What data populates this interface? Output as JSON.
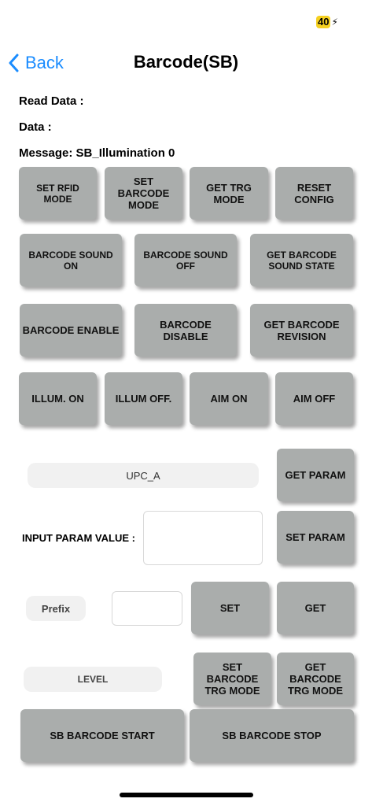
{
  "status": {
    "battery": "40",
    "bolt": "⚡"
  },
  "nav": {
    "back_label": "Back",
    "title": "Barcode(SB)"
  },
  "info": {
    "read_data": "Read Data :",
    "data": "Data :",
    "message": "Message: SB_Illumination 0"
  },
  "row1": [
    "SET RFID MODE",
    "SET BARCODE MODE",
    "GET TRG MODE",
    "RESET CONFIG"
  ],
  "row2": [
    "BARCODE SOUND ON",
    "BARCODE SOUND OFF",
    "GET BARCODE SOUND STATE"
  ],
  "row3": [
    "BARCODE ENABLE",
    "BARCODE DISABLE",
    "GET BARCODE REVISION"
  ],
  "row4": [
    "ILLUM. ON",
    "ILLUM OFF.",
    "AIM ON",
    "AIM OFF"
  ],
  "param": {
    "selected": "UPC_A",
    "get_label": "GET PARAM",
    "input_label": "INPUT PARAM VALUE :",
    "input_value": "",
    "set_label": "SET PARAM"
  },
  "prefix": {
    "label": "Prefix",
    "value": "",
    "set_label": "SET",
    "get_label": "GET"
  },
  "level": {
    "label": "LEVEL",
    "set_label": "SET BARCODE TRG MODE",
    "get_label": "GET BARCODE TRG MODE"
  },
  "scan": {
    "start_label": "SB BARCODE START",
    "stop_label": "SB BARCODE STOP"
  }
}
